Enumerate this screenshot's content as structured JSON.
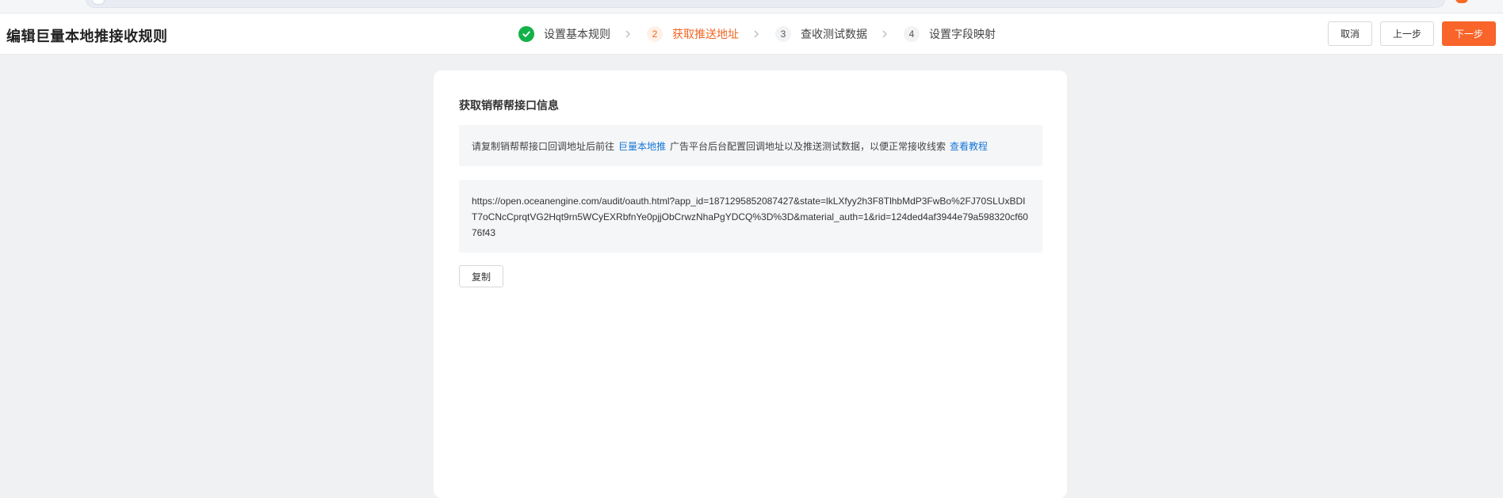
{
  "page": {
    "title": "编辑巨量本地推接收规则"
  },
  "steps": [
    {
      "label": "设置基本规则",
      "number": "",
      "status": "done"
    },
    {
      "label": "获取推送地址",
      "number": "2",
      "status": "active"
    },
    {
      "label": "查收测试数据",
      "number": "3",
      "status": "pending"
    },
    {
      "label": "设置字段映射",
      "number": "4",
      "status": "pending"
    }
  ],
  "actions": {
    "cancel_label": "取消",
    "prev_label": "上一步",
    "next_label": "下一步"
  },
  "card": {
    "title": "获取销帮帮接口信息",
    "notice_prefix": "请复制销帮帮接口回调地址后前往",
    "notice_link_platform": "巨量本地推",
    "notice_middle": "广告平台后台配置回调地址以及推送测试数据，以便正常接收线索",
    "notice_link_tutorial": "查看教程",
    "url": "https://open.oceanengine.com/audit/oauth.html?app_id=1871295852087427&state=lkLXfyy2h3F8TlhbMdP3FwBo%2FJ70SLUxBDIT7oCNcCprqtVG2Hqt9rn5WCyEXRbfnYe0pjjObCrwzNhaPgYDCQ%3D%3D&material_auth=1&rid=124ded4af3944e79a598320cf6076f43",
    "copy_label": "复制"
  },
  "colors": {
    "accent": "#f8642a",
    "active_step": "#f26522",
    "done_step": "#14b14a",
    "link": "#1677d9"
  }
}
